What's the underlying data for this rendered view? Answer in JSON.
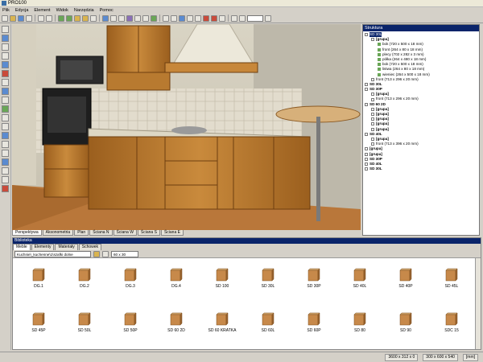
{
  "app": {
    "title": "PRO100"
  },
  "menu": [
    "Plik",
    "Edycja",
    "Element",
    "Widok",
    "Narzędzia",
    "Pomoc"
  ],
  "view_tabs": [
    "Perspektywa",
    "Aksonometria",
    "Plan",
    "Ściana N",
    "Ściana W",
    "Ściana S",
    "Ściana E"
  ],
  "structure": {
    "title": "Struktura",
    "rows": [
      {
        "indent": 0,
        "text": "SD 30L",
        "style": "sel",
        "sign": "−"
      },
      {
        "indent": 1,
        "text": "[grupa]",
        "style": "b",
        "sign": "−"
      },
      {
        "indent": 2,
        "text": "bok (720 x 500 x 18 mm)",
        "style": "",
        "sign": ""
      },
      {
        "indent": 2,
        "text": "front (264 x 80 x 18 mm)",
        "style": "",
        "sign": ""
      },
      {
        "indent": 2,
        "text": "plecy (702 x 282 x 3 mm)",
        "style": "",
        "sign": ""
      },
      {
        "indent": 2,
        "text": "półka (264 x 480 x 18 mm)",
        "style": "",
        "sign": ""
      },
      {
        "indent": 2,
        "text": "bok (720 x 500 x 18 mm)",
        "style": "",
        "sign": ""
      },
      {
        "indent": 2,
        "text": "listwa (264 x 80 x 18 mm)",
        "style": "",
        "sign": ""
      },
      {
        "indent": 2,
        "text": "wieniec (264 x 500 x 18 mm)",
        "style": "",
        "sign": ""
      },
      {
        "indent": 1,
        "text": "front (713 x 296 x 20 mm)",
        "style": "",
        "sign": "+"
      },
      {
        "indent": 0,
        "text": "SD 30L",
        "style": "b",
        "sign": "+"
      },
      {
        "indent": 0,
        "text": "SD 30P",
        "style": "b",
        "sign": "−"
      },
      {
        "indent": 1,
        "text": "[grupa]",
        "style": "b",
        "sign": "+"
      },
      {
        "indent": 1,
        "text": "front (713 x 296 x 20 mm)",
        "style": "",
        "sign": "+"
      },
      {
        "indent": 0,
        "text": "SD 60 2D",
        "style": "b",
        "sign": "−"
      },
      {
        "indent": 1,
        "text": "[grupa]",
        "style": "b",
        "sign": "+"
      },
      {
        "indent": 1,
        "text": "[grupa]",
        "style": "b",
        "sign": "+"
      },
      {
        "indent": 1,
        "text": "[grupa]",
        "style": "b",
        "sign": "+"
      },
      {
        "indent": 1,
        "text": "[grupa]",
        "style": "b",
        "sign": "+"
      },
      {
        "indent": 1,
        "text": "[grupa]",
        "style": "b",
        "sign": "+"
      },
      {
        "indent": 0,
        "text": "SD 40L",
        "style": "b",
        "sign": "−"
      },
      {
        "indent": 1,
        "text": "[grupa]",
        "style": "b",
        "sign": "+"
      },
      {
        "indent": 1,
        "text": "front (713 x 396 x 20 mm)",
        "style": "",
        "sign": "+"
      },
      {
        "indent": 0,
        "text": "[grupa]",
        "style": "b",
        "sign": "+"
      },
      {
        "indent": 0,
        "text": "[grupa]",
        "style": "b",
        "sign": "+"
      },
      {
        "indent": 0,
        "text": "SD 30P",
        "style": "b",
        "sign": "+"
      },
      {
        "indent": 0,
        "text": "SD 40L",
        "style": "b",
        "sign": "+"
      },
      {
        "indent": 0,
        "text": "SD 30L",
        "style": "b",
        "sign": "+"
      }
    ]
  },
  "library": {
    "title": "Biblioteka",
    "tabs": [
      "Meble",
      "Elementy",
      "Materiały",
      "Schowek"
    ],
    "path": "Kuchnie\\_kuchenne\\1\\szafki dolne",
    "size": "60 x 30",
    "items": [
      "DG.1",
      "DG.2",
      "DG.3",
      "DG.4",
      "SD 100",
      "SD 30L",
      "SD 30P",
      "SD 40L",
      "SD 40P",
      "SD 45L",
      "SD 45P",
      "SD 50L",
      "SD 50P",
      "SD 60 2D",
      "SD 60 KRATKA",
      "SD 60L",
      "SD 60P",
      "SD 80",
      "SD 90",
      "SDC 15"
    ]
  },
  "status": {
    "dims": "3600 x 312 x 0",
    "size": "300 x 600 x 540",
    "unit": "[mm]"
  },
  "colors": {
    "selection": "#0a246a",
    "wood": "#b5792e",
    "chrome": "#d4d0c8"
  }
}
